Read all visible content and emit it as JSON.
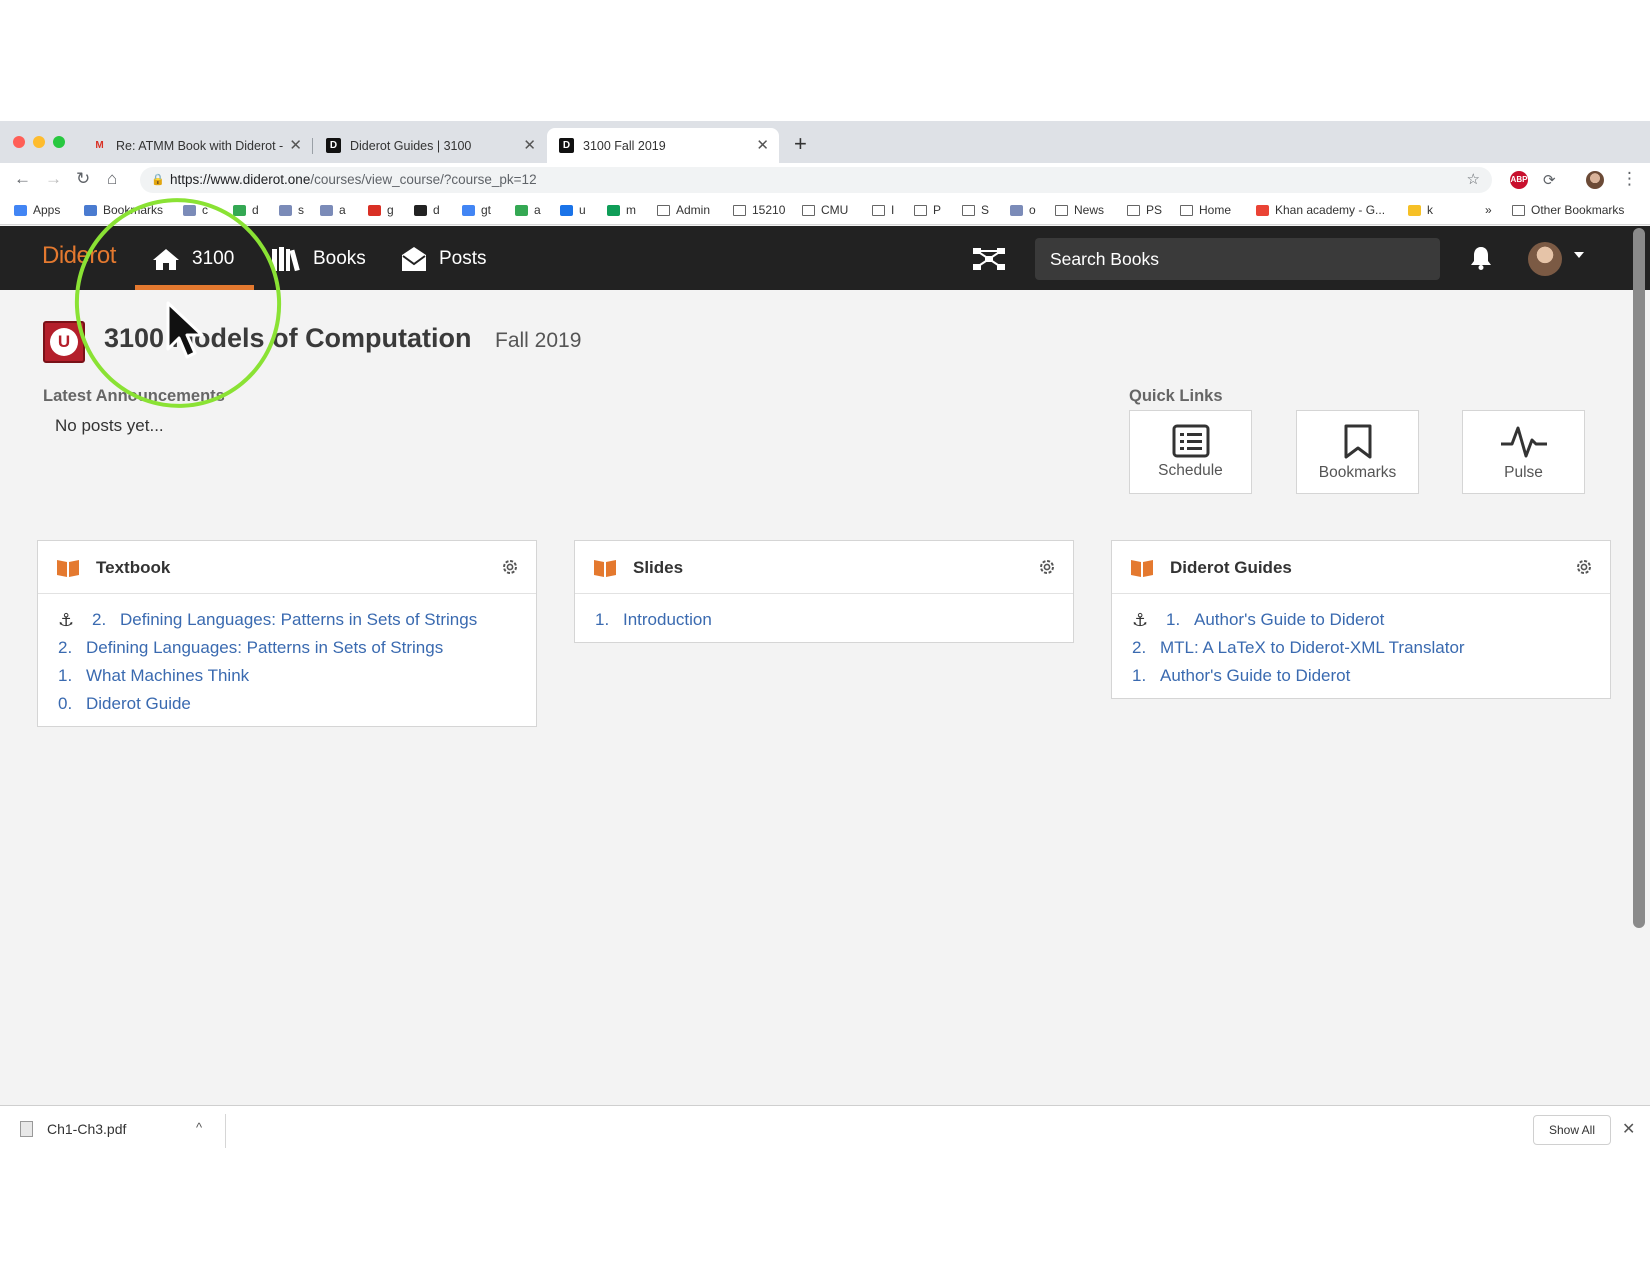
{
  "browser": {
    "tabs": [
      {
        "label": "Re: ATMM Book with Diderot -",
        "icon": "gmail-icon"
      },
      {
        "label": "Diderot Guides | 3100",
        "icon": "diderot-favicon"
      },
      {
        "label": "3100 Fall 2019",
        "icon": "diderot-favicon",
        "active": true
      }
    ],
    "url_host": "https://www.diderot.one",
    "url_path": "/courses/view_course/?course_pk=12",
    "bookmarks": [
      {
        "label": "Apps",
        "icon": "apps-grid-icon"
      },
      {
        "label": "Bookmarks",
        "icon": "star-icon"
      },
      {
        "label": "c",
        "icon": "site-icon"
      },
      {
        "label": "d",
        "icon": "drive-icon"
      },
      {
        "label": "s",
        "icon": "site-icon"
      },
      {
        "label": "a",
        "icon": "site-icon"
      },
      {
        "label": "g",
        "icon": "gmail-icon"
      },
      {
        "label": "d",
        "icon": "github-icon"
      },
      {
        "label": "gt",
        "icon": "translate-icon"
      },
      {
        "label": "a",
        "icon": "drive-icon"
      },
      {
        "label": "u",
        "icon": "calendar-icon"
      },
      {
        "label": "m",
        "icon": "maps-icon"
      },
      {
        "label": "Admin",
        "icon": "folder-icon"
      },
      {
        "label": "15210",
        "icon": "folder-icon"
      },
      {
        "label": "CMU",
        "icon": "folder-icon"
      },
      {
        "label": "I",
        "icon": "folder-icon"
      },
      {
        "label": "P",
        "icon": "folder-icon"
      },
      {
        "label": "S",
        "icon": "folder-icon"
      },
      {
        "label": "o",
        "icon": "site-icon"
      },
      {
        "label": "News",
        "icon": "folder-icon"
      },
      {
        "label": "PS",
        "icon": "folder-icon"
      },
      {
        "label": "Home",
        "icon": "folder-icon"
      },
      {
        "label": "Khan academy - G...",
        "icon": "google-icon"
      },
      {
        "label": "k",
        "icon": "keep-icon"
      }
    ],
    "overflow_label": "»",
    "other_bookmarks": "Other Bookmarks",
    "extensions": [
      "ABP"
    ]
  },
  "app": {
    "logo": "Diderot",
    "nav": [
      {
        "label": "3100",
        "icon": "home-icon",
        "active": true
      },
      {
        "label": "Books",
        "icon": "books-icon"
      },
      {
        "label": "Posts",
        "icon": "posts-icon"
      }
    ],
    "search_placeholder": "Search Books"
  },
  "course": {
    "title": "3100 Models of Computation",
    "term": "Fall 2019",
    "announcements_title": "Latest Announcements",
    "announcements_empty": "No posts yet...",
    "quick_links_title": "Quick Links",
    "quick_links": [
      {
        "label": "Schedule",
        "icon": "list-icon"
      },
      {
        "label": "Bookmarks",
        "icon": "bookmark-icon"
      },
      {
        "label": "Pulse",
        "icon": "pulse-icon"
      }
    ],
    "panels": [
      {
        "title": "Textbook",
        "rows": [
          {
            "num": "2.",
            "text": "Defining Languages: Patterns in Sets of Strings",
            "pinned": true
          },
          {
            "num": "2.",
            "text": "Defining Languages: Patterns in Sets of Strings"
          },
          {
            "num": "1.",
            "text": "What Machines Think"
          },
          {
            "num": "0.",
            "text": "Diderot Guide"
          }
        ]
      },
      {
        "title": "Slides",
        "rows": [
          {
            "num": "1.",
            "text": "Introduction"
          }
        ]
      },
      {
        "title": "Diderot Guides",
        "rows": [
          {
            "num": "1.",
            "text": "Author's Guide to Diderot",
            "pinned": true
          },
          {
            "num": "2.",
            "text": "MTL: A LaTeX to Diderot-XML Translator"
          },
          {
            "num": "1.",
            "text": "Author's Guide to Diderot"
          }
        ]
      }
    ]
  },
  "downloads": {
    "file": "Ch1-Ch3.pdf",
    "show_all": "Show All"
  },
  "colors": {
    "accent": "#e4792f",
    "nav_bg": "#222222",
    "link": "#3a6ab0",
    "annotation": "#8ae234"
  }
}
